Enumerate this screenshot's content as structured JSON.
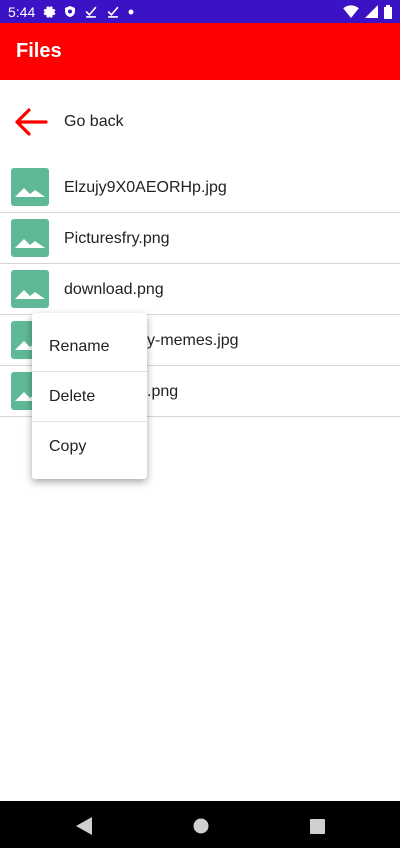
{
  "status_bar": {
    "time": "5:44",
    "icons_left": [
      "gear-icon",
      "shield-icon",
      "check-icon",
      "check-icon",
      "dot-icon"
    ],
    "icons_right": [
      "wifi-icon",
      "signal-icon",
      "battery-icon"
    ],
    "background": "#3b12c4"
  },
  "app_bar": {
    "title": "Files",
    "background": "#ff0000"
  },
  "go_back": {
    "label": "Go back",
    "icon": "arrow-left-icon",
    "icon_color": "#ff0000"
  },
  "files": [
    {
      "name": "Elzujy9X0AEORHp.jpg",
      "icon": "image-icon"
    },
    {
      "name": "Picturesfry.png",
      "icon": "image-icon"
    },
    {
      "name": "download.png",
      "icon": "image-icon"
    },
    {
      "name": "y-memes.jpg",
      "icon": "image-icon"
    },
    {
      "name": ".png",
      "icon": "image-icon"
    }
  ],
  "context_menu": {
    "items": [
      "Rename",
      "Delete",
      "Copy"
    ]
  },
  "nav_bar": {
    "buttons": [
      "back-icon",
      "home-icon",
      "recents-icon"
    ]
  },
  "colors": {
    "thumb": "#5fb996"
  }
}
